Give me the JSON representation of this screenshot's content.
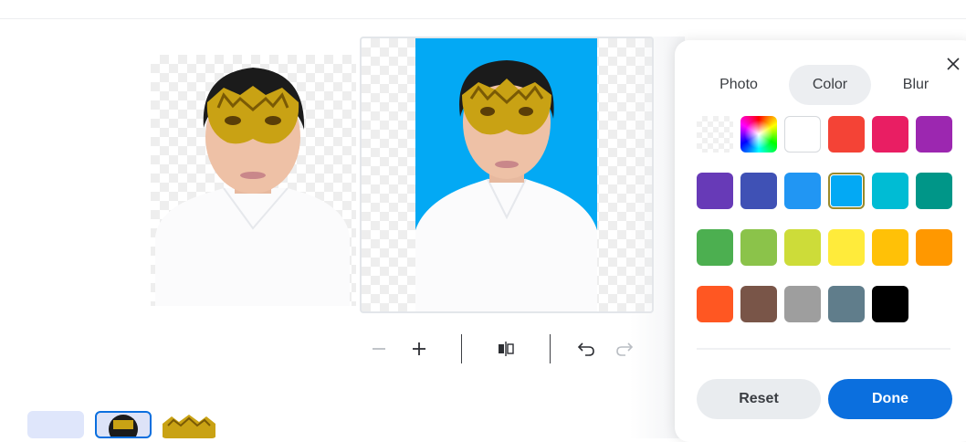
{
  "editor": {
    "zoom_out_icon": "minus-icon",
    "zoom_in_icon": "plus-icon",
    "flip_icon": "flip-horizontal-icon",
    "undo_icon": "undo-icon",
    "redo_icon": "redo-icon"
  },
  "background_panel": {
    "tabs": [
      {
        "label": "Photo",
        "active": false
      },
      {
        "label": "Color",
        "active": true
      },
      {
        "label": "Blur",
        "active": false
      }
    ],
    "close_icon": "close-icon",
    "swatches": [
      [
        "transparent",
        "rainbow",
        "#ffffff",
        "#f44336",
        "#e91e63",
        "#9c27b0"
      ],
      [
        "#673ab7",
        "#3f51b5",
        "#2196f3",
        "#03a9f4",
        "#00bcd4",
        "#009688"
      ],
      [
        "#4caf50",
        "#8bc34a",
        "#cddc39",
        "#ffeb3b",
        "#ffc107",
        "#ff9800"
      ],
      [
        "#ff5722",
        "#795548",
        "#9e9e9e",
        "#607d8b",
        "#000000"
      ]
    ],
    "selected_color": "#03a9f4",
    "reset_label": "Reset",
    "done_label": "Done"
  },
  "colors": {
    "accent": "#0b6fde",
    "photo_background": "#03a9f4"
  }
}
